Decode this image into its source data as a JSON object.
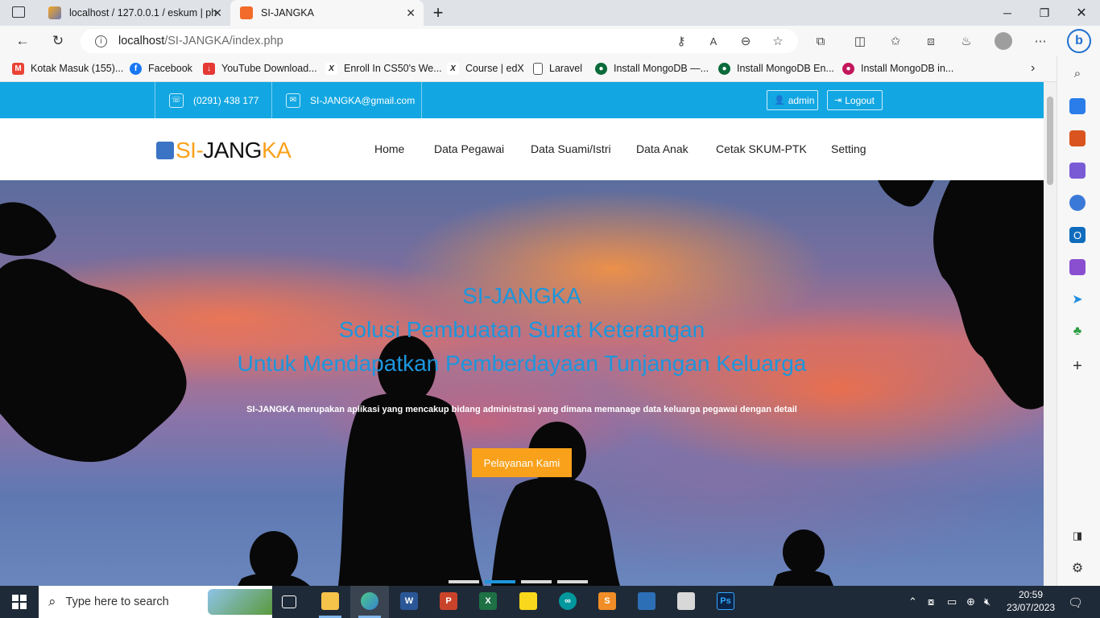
{
  "browser": {
    "tabs": [
      {
        "title": "localhost / 127.0.0.1 / eskum | ph"
      },
      {
        "title": "SI-JANGKA"
      }
    ],
    "url_host": "localhost",
    "url_path": "/SI-JANGKA/index.php",
    "bookmarks": [
      {
        "label": "Kotak Masuk (155)...",
        "icon": "gmail-icon",
        "color": "#ea4335"
      },
      {
        "label": "Facebook",
        "icon": "facebook-icon",
        "color": "#1877f2"
      },
      {
        "label": "YouTube Download...",
        "icon": "download-icon",
        "color": "#e53935"
      },
      {
        "label": "Enroll In CS50's We...",
        "icon": "edx-icon",
        "color": "#222222"
      },
      {
        "label": "Course | edX",
        "icon": "edx-icon",
        "color": "#222222"
      },
      {
        "label": "Laravel",
        "icon": "page-icon",
        "color": "#777777"
      },
      {
        "label": "Install MongoDB —...",
        "icon": "mongodb-icon",
        "color": "#0b6b3a"
      },
      {
        "label": "Install MongoDB En...",
        "icon": "mongodb-icon",
        "color": "#0b6b3a"
      },
      {
        "label": "Install MongoDB in...",
        "icon": "mongodb-icon",
        "color": "#c2185b"
      }
    ]
  },
  "site": {
    "topbar": {
      "phone": "(0291) 438 177",
      "email": "SI-JANGKA@gmail.com",
      "admin_label": "admin",
      "logout_label": "Logout"
    },
    "logo": {
      "part1": "SI-",
      "part2": "JANG",
      "part3": "KA"
    },
    "nav": [
      "Home",
      "Data Pegawai",
      "Data Suami/Istri",
      "Data Anak",
      "Cetak SKUM-PTK",
      "Setting"
    ],
    "hero": {
      "line1": "SI-JANGKA",
      "line2": "Solusi Pembuatan Surat Keterangan",
      "line3": "Untuk Mendapatkan Pemberdayaan Tunjangan Keluarga",
      "description": "SI-JANGKA merupakan aplikasi yang mencakup bidang administrasi yang dimana memanage data keluarga pegawai dengan detail",
      "button": "Pelayanan Kami",
      "active_slide": 2,
      "slide_count": 4
    },
    "colors": {
      "topbar": "#12a7e2",
      "accent": "#f9a11b",
      "hero_text": "#1c96dd"
    }
  },
  "taskbar": {
    "search_placeholder": "Type here to search",
    "time": "20:59",
    "date": "23/07/2023"
  }
}
